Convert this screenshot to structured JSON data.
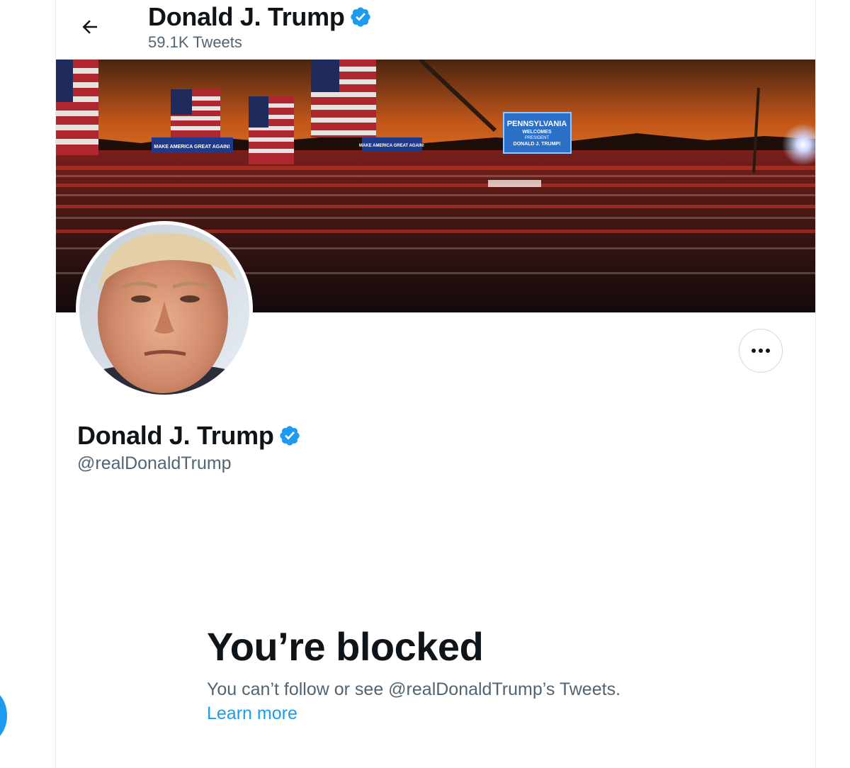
{
  "header": {
    "name": "Donald J. Trump",
    "tweet_count": "59.1K Tweets"
  },
  "banner": {
    "sign_main": "PENNSYLVANIA",
    "sign_sub1": "WELCOMES",
    "sign_sub2": "PRESIDENT",
    "sign_sub3": "DONALD J. TRUMP!",
    "banner_left": "MAKE AMERICA GREAT AGAIN!",
    "banner_mid": "MAKE AMERICA GREAT AGAIN!"
  },
  "profile": {
    "name": "Donald J. Trump",
    "handle": "@realDonaldTrump"
  },
  "blocked": {
    "title": "You’re blocked",
    "message": "You can’t follow or see @realDonaldTrump’s Tweets.",
    "learn_more": "Learn more"
  },
  "colors": {
    "accent": "#1d9bf0",
    "secondary_text": "#536471",
    "border": "#cfd9de"
  },
  "icons": {
    "back": "arrow-left-icon",
    "verified": "verified-badge-icon",
    "more": "more-horizontal-icon"
  }
}
